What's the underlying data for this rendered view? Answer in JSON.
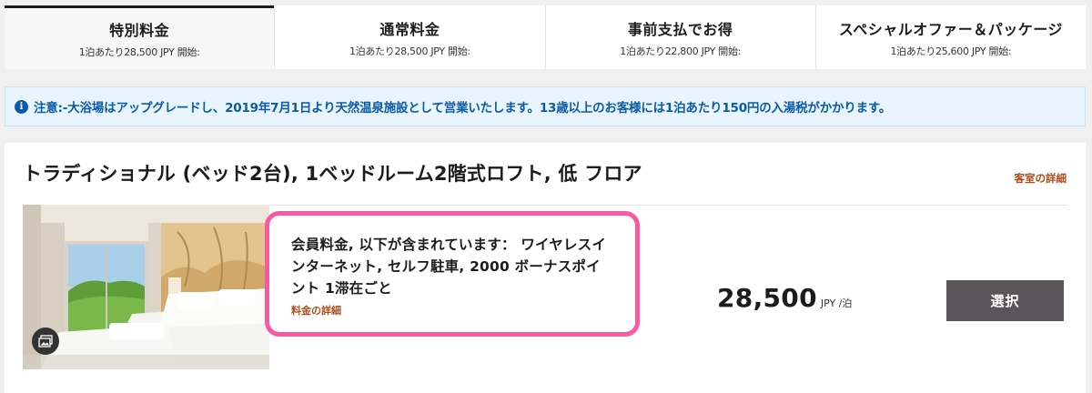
{
  "tabs": [
    {
      "title": "特別料金",
      "subtitle": "1泊あたり28,500 JPY 開始:",
      "active": true
    },
    {
      "title": "通常料金",
      "subtitle": "1泊あたり28,500 JPY 開始:",
      "active": false
    },
    {
      "title": "事前支払でお得",
      "subtitle": "1泊あたり22,800 JPY 開始:",
      "active": false
    },
    {
      "title": "スペシャルオファー＆パッケージ",
      "subtitle": "1泊あたり25,600 JPY 開始:",
      "active": false
    }
  ],
  "notice": {
    "icon": "info-icon",
    "icon_glyph": "i",
    "text": "注意:-大浴場はアップグレードし、2019年7月1日より天然温泉施設として営業いたします。13歳以上のお客様には1泊あたり150円の入湯税がかかります。"
  },
  "room": {
    "title": "トラディショナル (ベッド2台), 1ベッドルーム2階式ロフト, 低 フロア",
    "details_link": "客室の詳細",
    "rate": {
      "description": "会員料金, 以下が含まれています： ワイヤレスインターネット, セルフ駐車, 2000 ボーナスポイント 1滞在ごと",
      "details_link": "料金の詳細"
    },
    "price": {
      "amount": "28,500",
      "unit": "JPY /泊"
    },
    "select_label": "選択"
  },
  "colors": {
    "link": "#b14a18",
    "notice_text": "#0b5aa8",
    "highlight_border": "#f55aa2",
    "select_button": "#5b5559"
  }
}
